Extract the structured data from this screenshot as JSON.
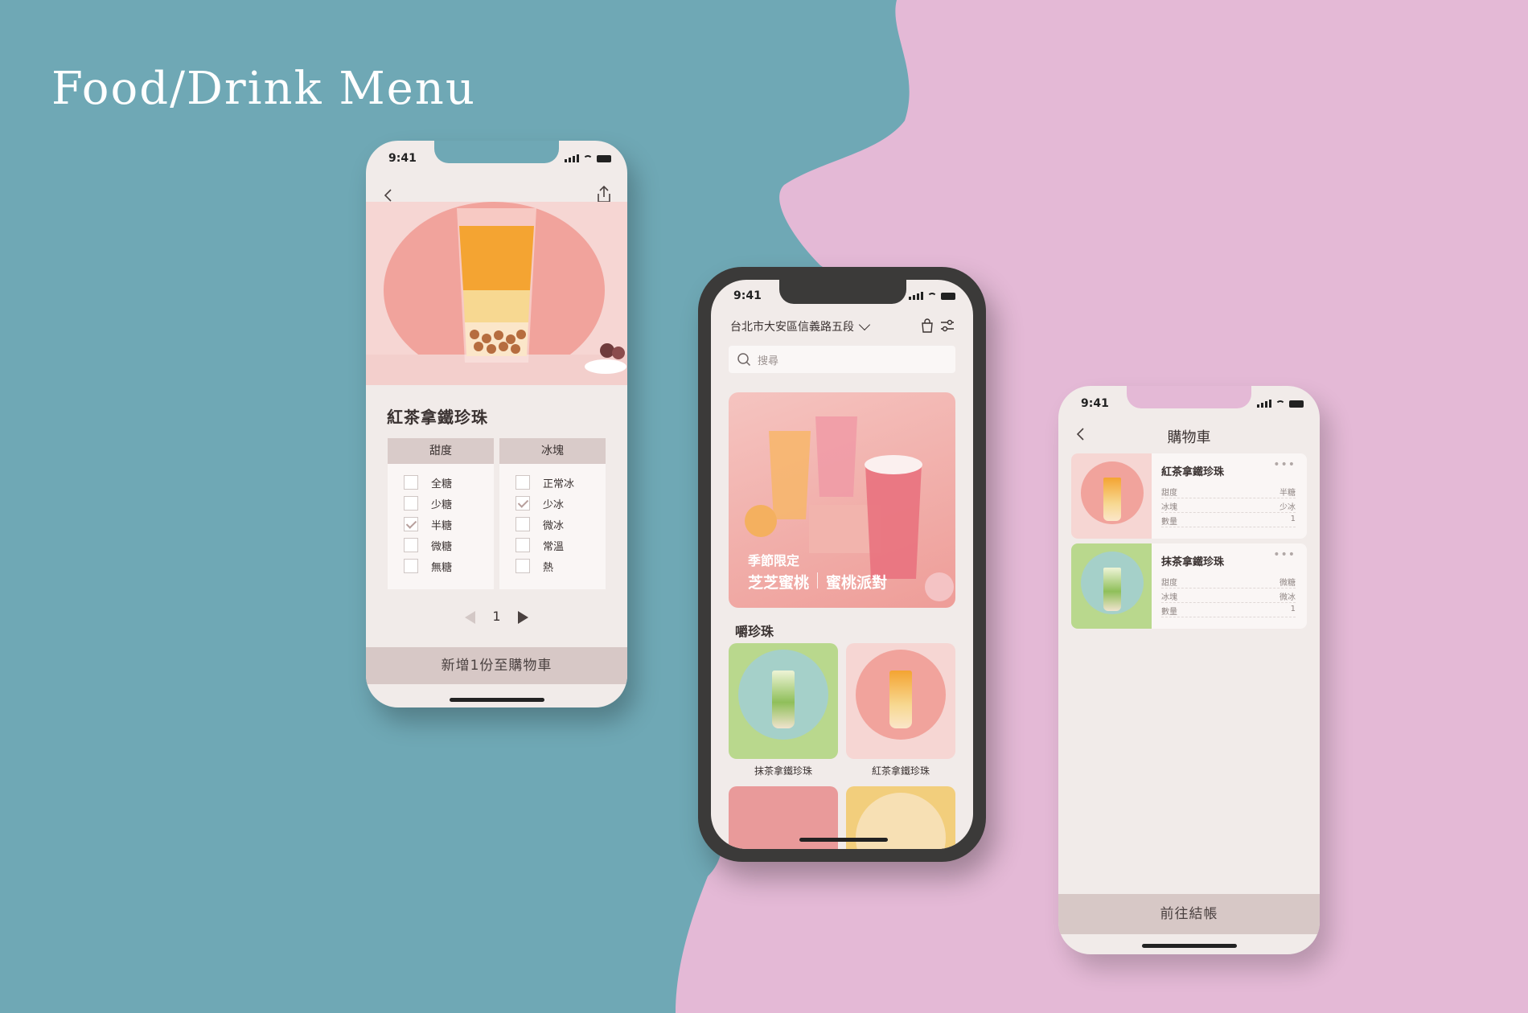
{
  "headline": "Food/Drink Menu",
  "colors": {
    "teal_bg": "#6fa8b5",
    "pink_bg": "#e4b9d6",
    "accent_rose": "#d7c8c6",
    "screen_bg": "#f1ebe9"
  },
  "left_phone": {
    "time": "9:41",
    "product_title": "紅茶拿鐵珍珠",
    "sweetness": {
      "header": "甜度",
      "options": [
        {
          "label": "全糖",
          "checked": false
        },
        {
          "label": "少糖",
          "checked": false
        },
        {
          "label": "半糖",
          "checked": true
        },
        {
          "label": "微糖",
          "checked": false
        },
        {
          "label": "無糖",
          "checked": false
        }
      ]
    },
    "ice": {
      "header": "冰塊",
      "options": [
        {
          "label": "正常冰",
          "checked": false
        },
        {
          "label": "少冰",
          "checked": true
        },
        {
          "label": "微冰",
          "checked": false
        },
        {
          "label": "常溫",
          "checked": false
        },
        {
          "label": "熱",
          "checked": false
        }
      ]
    },
    "quantity": "1",
    "add_button": "新增1份至購物車"
  },
  "center_phone": {
    "time": "9:41",
    "address": "台北市大安區信義路五段",
    "search_placeholder": "搜尋",
    "banner": {
      "kicker": "季節限定",
      "title_a": "芝芝蜜桃",
      "title_b": "蜜桃派對"
    },
    "section_title": "嚼珍珠",
    "cards": [
      {
        "label": "抹茶拿鐵珍珠"
      },
      {
        "label": "紅茶拿鐵珍珠"
      }
    ]
  },
  "right_phone": {
    "time": "9:41",
    "title": "購物車",
    "more_glyph": "•••",
    "items": [
      {
        "name": "紅茶拿鐵珍珠",
        "rows": [
          {
            "k": "甜度",
            "v": "半糖"
          },
          {
            "k": "冰塊",
            "v": "少冰"
          },
          {
            "k": "數量",
            "v": "1"
          }
        ]
      },
      {
        "name": "抹茶拿鐵珍珠",
        "rows": [
          {
            "k": "甜度",
            "v": "微糖"
          },
          {
            "k": "冰塊",
            "v": "微冰"
          },
          {
            "k": "數量",
            "v": "1"
          }
        ]
      }
    ],
    "checkout_button": "前往結帳"
  }
}
